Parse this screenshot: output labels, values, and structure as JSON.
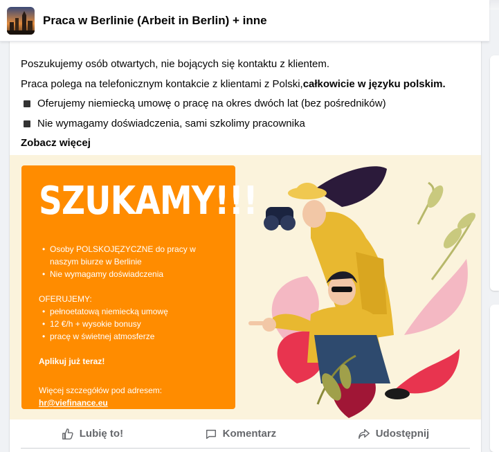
{
  "header": {
    "group_title": "Praca w Berlinie (Arbeit in Berlin) + inne"
  },
  "post": {
    "line1": "Poszukujemy osób otwartych, nie bojących się kontaktu z klientem.",
    "line2_prefix": "Praca polega na telefonicznym kontakcie z klientami z Polski,",
    "line2_bold": "całkowicie w języku polskim.",
    "bullets": [
      "Oferujemy niemiecką umowę o pracę na okres dwóch lat (bez pośredników)",
      "Nie wymagamy doświadczenia, sami szkolimy pracownika"
    ],
    "see_more": "Zobacz więcej"
  },
  "ad": {
    "headline": "SZUKAMY!!!",
    "list1": [
      "Osoby POLSKOJĘZYCZNE do pracy w naszym biurze w Berlinie",
      "Nie wymagamy doświadczenia"
    ],
    "offer_heading": "OFERUJEMY:",
    "offers": [
      "pełnoetatową niemiecką umowę",
      "12 €/h + wysokie bonusy",
      "pracę w świetnej atmosferze"
    ],
    "apply": "Aplikuj już teraz!",
    "details_label": "Więcej szczegółów pod adresem:",
    "email": "hr@viefinance.eu"
  },
  "actions": {
    "like": "Lubię to!",
    "comment": "Komentarz",
    "share": "Udostępnij"
  },
  "colors": {
    "orange": "#ff8c00",
    "cream": "#fbf3dc",
    "action_gray": "#65676b"
  }
}
